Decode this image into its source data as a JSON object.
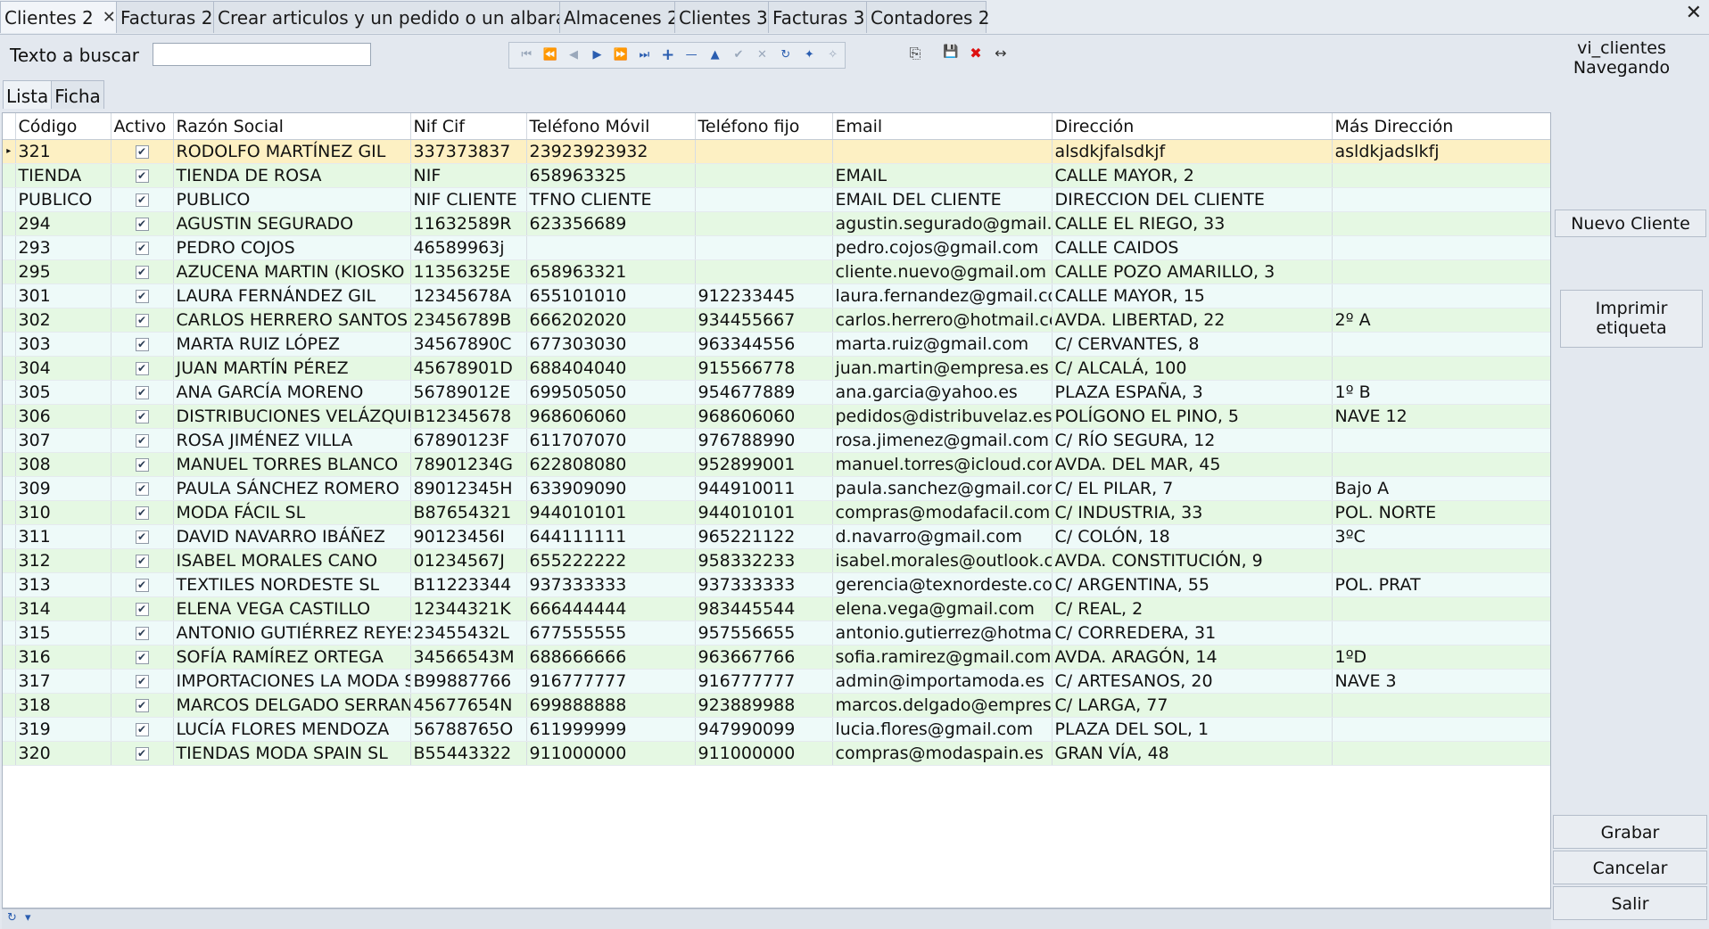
{
  "tabs": [
    {
      "label": "Clientes 2",
      "close": "✕"
    },
    {
      "label": "Facturas 2"
    },
    {
      "label": "Crear articulos y un pedido o un albaran"
    },
    {
      "label": "Almacenes 2"
    },
    {
      "label": "Clientes 3"
    },
    {
      "label": "Facturas 3"
    },
    {
      "label": "Contadores 2"
    }
  ],
  "window_close": "✕",
  "search": {
    "label": "Texto a buscar",
    "value": "",
    "placeholder": ""
  },
  "status": {
    "view": "vi_clientes",
    "mode": "Navegando"
  },
  "subtabs": [
    "Lista",
    "Ficha"
  ],
  "icons": {
    "first": "⏮",
    "prev_page": "⏪",
    "prev": "◀",
    "next": "▶",
    "next_page": "⏩",
    "last": "⏭",
    "add": "+",
    "delete": "—",
    "up": "▲",
    "confirm": "✔",
    "cancel": "✕",
    "refresh": "↻",
    "star": "✦",
    "add_star": "✧",
    "export": "⎘",
    "save_tool": "💾",
    "delete_tool": "✖",
    "resize": "↔"
  },
  "grid": {
    "columns": [
      "Código",
      "Activo",
      "Razón Social",
      "Nif Cif",
      "Teléfono Móvil",
      "Teléfono fijo",
      "Email",
      "Dirección",
      "Más Dirección"
    ],
    "rows": [
      [
        "321",
        "✔",
        "RODOLFO MARTÍNEZ GIL",
        "337373837",
        "23923923932",
        "",
        "",
        "alsdkjfalsdkjf",
        "asldkjadslkfj"
      ],
      [
        "TIENDA",
        "✔",
        "TIENDA DE ROSA",
        "NIF",
        "658963325",
        "",
        "EMAIL",
        "CALLE MAYOR, 2",
        ""
      ],
      [
        "PUBLICO",
        "✔",
        "PUBLICO",
        "NIF CLIENTE",
        "TFNO CLIENTE",
        "",
        "EMAIL DEL CLIENTE",
        "DIRECCION DEL CLIENTE",
        ""
      ],
      [
        "294",
        "✔",
        "AGUSTIN SEGURADO",
        "11632589R",
        "623356689",
        "",
        "agustin.segurado@gmail.c",
        "CALLE EL RIEGO, 33",
        ""
      ],
      [
        "293",
        "✔",
        "PEDRO COJOS",
        "46589963j",
        "",
        "",
        "pedro.cojos@gmail.com",
        "CALLE CAIDOS",
        ""
      ],
      [
        "295",
        "✔",
        "AZUCENA MARTIN (KIOSKO",
        "11356325E",
        "658963321",
        "",
        "cliente.nuevo@gmail.om",
        "CALLE POZO AMARILLO, 3",
        ""
      ],
      [
        "301",
        "✔",
        "LAURA FERNÁNDEZ GIL",
        "12345678A",
        "655101010",
        "912233445",
        "laura.fernandez@gmail.co",
        "CALLE MAYOR, 15",
        ""
      ],
      [
        "302",
        "✔",
        "CARLOS HERRERO SANTOS",
        "23456789B",
        "666202020",
        "934455667",
        "carlos.herrero@hotmail.cc",
        "AVDA. LIBERTAD, 22",
        "2º A"
      ],
      [
        "303",
        "✔",
        "MARTA RUIZ LÓPEZ",
        "34567890C",
        "677303030",
        "963344556",
        "marta.ruiz@gmail.com",
        "C/ CERVANTES, 8",
        ""
      ],
      [
        "304",
        "✔",
        "JUAN MARTÍN PÉREZ",
        "45678901D",
        "688404040",
        "915566778",
        "juan.martin@empresa.es",
        "C/ ALCALÁ, 100",
        ""
      ],
      [
        "305",
        "✔",
        "ANA GARCÍA MORENO",
        "56789012E",
        "699505050",
        "954677889",
        "ana.garcia@yahoo.es",
        "PLAZA ESPAÑA, 3",
        "1º B"
      ],
      [
        "306",
        "✔",
        "DISTRIBUCIONES VELÁZQUE",
        "B12345678",
        "968606060",
        "968606060",
        "pedidos@distribuvelaz.es",
        "POLÍGONO EL PINO, 5",
        "NAVE 12"
      ],
      [
        "307",
        "✔",
        "ROSA JIMÉNEZ VILLA",
        "67890123F",
        "611707070",
        "976788990",
        "rosa.jimenez@gmail.com",
        "C/ RÍO SEGURA, 12",
        ""
      ],
      [
        "308",
        "✔",
        "MANUEL TORRES BLANCO",
        "78901234G",
        "622808080",
        "952899001",
        "manuel.torres@icloud.cor",
        "AVDA. DEL MAR, 45",
        ""
      ],
      [
        "309",
        "✔",
        "PAULA SÁNCHEZ ROMERO",
        "89012345H",
        "633909090",
        "944910011",
        "paula.sanchez@gmail.com",
        "C/ EL PILAR, 7",
        "Bajo A"
      ],
      [
        "310",
        "✔",
        "MODA FÁCIL SL",
        "B87654321",
        "944010101",
        "944010101",
        "compras@modafacil.com",
        "C/ INDUSTRIA, 33",
        "POL. NORTE"
      ],
      [
        "311",
        "✔",
        "DAVID NAVARRO IBÁÑEZ",
        "90123456I",
        "644111111",
        "965221122",
        "d.navarro@gmail.com",
        "C/ COLÓN, 18",
        "3ºC"
      ],
      [
        "312",
        "✔",
        "ISABEL MORALES CANO",
        "01234567J",
        "655222222",
        "958332233",
        "isabel.morales@outlook.c",
        "AVDA. CONSTITUCIÓN, 9",
        ""
      ],
      [
        "313",
        "✔",
        "TEXTILES NORDESTE SL",
        "B11223344",
        "937333333",
        "937333333",
        "gerencia@texnordeste.cor",
        "C/ ARGENTINA, 55",
        "POL. PRAT"
      ],
      [
        "314",
        "✔",
        "ELENA VEGA CASTILLO",
        "12344321K",
        "666444444",
        "983445544",
        "elena.vega@gmail.com",
        "C/ REAL, 2",
        ""
      ],
      [
        "315",
        "✔",
        "ANTONIO GUTIÉRREZ REYES",
        "23455432L",
        "677555555",
        "957556655",
        "antonio.gutierrez@hotma",
        "C/ CORREDERA, 31",
        ""
      ],
      [
        "316",
        "✔",
        "SOFÍA RAMÍREZ ORTEGA",
        "34566543M",
        "688666666",
        "963667766",
        "sofia.ramirez@gmail.com",
        "AVDA. ARAGÓN, 14",
        "1ºD"
      ],
      [
        "317",
        "✔",
        "IMPORTACIONES LA MODA S",
        "B99887766",
        "916777777",
        "916777777",
        "admin@importamoda.es",
        "C/ ARTESANOS, 20",
        "NAVE 3"
      ],
      [
        "318",
        "✔",
        "MARCOS DELGADO SERRANO",
        "45677654N",
        "699888888",
        "923889988",
        "marcos.delgado@empresa",
        "C/ LARGA, 77",
        ""
      ],
      [
        "319",
        "✔",
        "LUCÍA FLORES MENDOZA",
        "56788765O",
        "611999999",
        "947990099",
        "lucia.flores@gmail.com",
        "PLAZA DEL SOL, 1",
        ""
      ],
      [
        "320",
        "✔",
        "TIENDAS MODA SPAIN SL",
        "B55443322",
        "911000000",
        "911000000",
        "compras@modaspain.es",
        "GRAN VÍA, 48",
        ""
      ]
    ]
  },
  "footer_icons": {
    "refresh": "↻",
    "filter": "▾"
  },
  "buttons": {
    "nuevo_cliente": "Nuevo Cliente",
    "imprimir_1": "Imprimir",
    "imprimir_2": "etiqueta",
    "grabar": "Grabar",
    "cancelar": "Cancelar",
    "salir": "Salir"
  }
}
